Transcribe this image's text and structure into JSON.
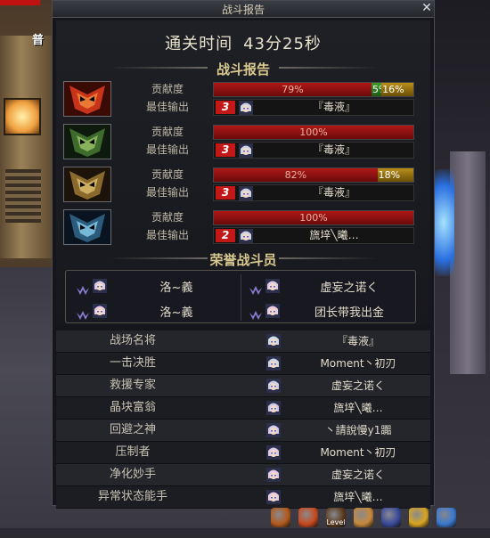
{
  "scene": {
    "tag": "普"
  },
  "window": {
    "title": "战斗报告",
    "close": "✕"
  },
  "clear_time": {
    "label": "通关时间",
    "value": "43分25秒"
  },
  "report_section_title": "战斗报告",
  "row_labels": {
    "contribution": "贡献度",
    "best_output": "最佳输出"
  },
  "players": [
    {
      "avatar": "flame-mask-icon",
      "contribution_pct": 79,
      "contribution_label": "79%",
      "extra": [
        {
          "type": "green",
          "pct": 5,
          "label": "5%"
        },
        {
          "type": "yellow",
          "pct": 16,
          "label": "16%"
        }
      ],
      "rank": "3",
      "best": "『毒液』"
    },
    {
      "avatar": "green-mask-icon",
      "contribution_pct": 100,
      "contribution_label": "100%",
      "extra": [],
      "rank": "3",
      "best": "『毒液』"
    },
    {
      "avatar": "gold-mask-icon",
      "contribution_pct": 82,
      "contribution_label": "82%",
      "extra": [
        {
          "type": "yellow",
          "pct": 18,
          "label": "18%"
        }
      ],
      "rank": "3",
      "best": "『毒液』"
    },
    {
      "avatar": "blue-mask-icon",
      "contribution_pct": 100,
      "contribution_label": "100%",
      "extra": [],
      "rank": "2",
      "best": "旒垶╲曦…"
    }
  ],
  "honor_section_title": "荣誉战斗员",
  "honor": [
    {
      "name": "洛~義"
    },
    {
      "name": "虚妄之诺く"
    },
    {
      "name": "洛~義"
    },
    {
      "name": "团长带我出金"
    }
  ],
  "awards": [
    {
      "title": "战场名将",
      "player": "『毒液』"
    },
    {
      "title": "一击决胜",
      "player": "Moment丶初刃"
    },
    {
      "title": "救援专家",
      "player": "虚妄之诺く"
    },
    {
      "title": "晶块富翁",
      "player": "旒垶╲曦…"
    },
    {
      "title": "回避之神",
      "player": "丶請說慢у1嚻"
    },
    {
      "title": "压制者",
      "player": "Moment丶初刃"
    },
    {
      "title": "净化妙手",
      "player": "虚妄之诺く"
    },
    {
      "title": "异常状态能手",
      "player": "旒垶╲曦…"
    }
  ],
  "toolbar": [
    "home-icon",
    "skill-icon",
    "level-icon",
    "character-icon",
    "inventory-icon",
    "coin-icon",
    "orb-icon"
  ],
  "toolbar_text": {
    "level": "Level"
  },
  "colors": {
    "bar_red": "#b01818",
    "bar_green": "#3f9b2c",
    "bar_yellow": "#b98e1a",
    "rank_red": "#c21818"
  }
}
